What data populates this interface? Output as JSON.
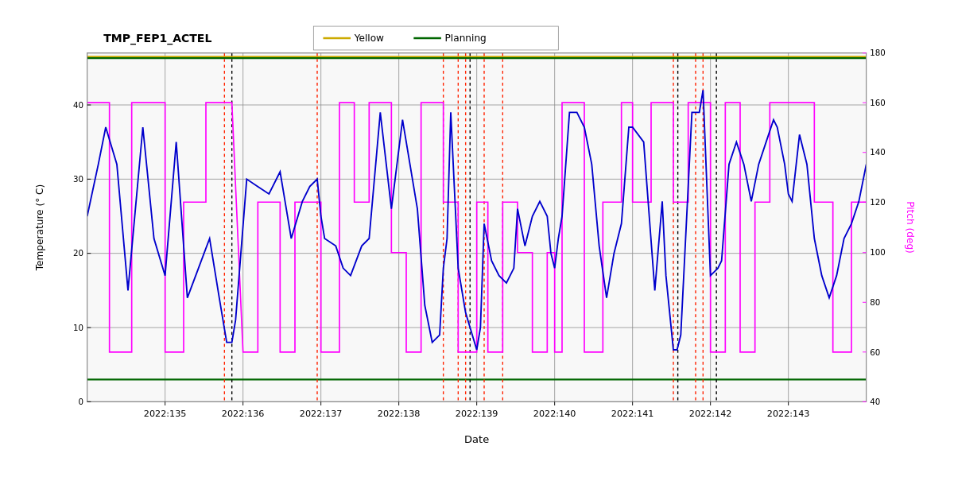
{
  "chart": {
    "title": "TMP_FEP1_ACTEL",
    "x_axis_label": "Date",
    "y_left_label": "Temperature (° C)",
    "y_right_label": "Pitch (deg)",
    "legend": {
      "yellow_label": "Yellow",
      "planning_label": "Planning"
    },
    "x_ticks": [
      "2022:135",
      "2022:136",
      "2022:137",
      "2022:138",
      "2022:139",
      "2022:140",
      "2022:141",
      "2022:142",
      "2022:143"
    ],
    "y_left_ticks": [
      "0",
      "10",
      "20",
      "30",
      "40"
    ],
    "y_right_ticks": [
      "40",
      "60",
      "80",
      "100",
      "120",
      "140",
      "160",
      "180"
    ],
    "yellow_limit": 47,
    "planning_limit_top": 47,
    "planning_limit_bottom": 3,
    "colors": {
      "blue_line": "#0000cc",
      "magenta_line": "#ff00ff",
      "yellow_limit": "#ccaa00",
      "planning_green": "#006600",
      "red_dotted": "#ff2200",
      "black_dotted": "#000000",
      "grid": "#cccccc",
      "background": "#f0f0f0"
    }
  }
}
